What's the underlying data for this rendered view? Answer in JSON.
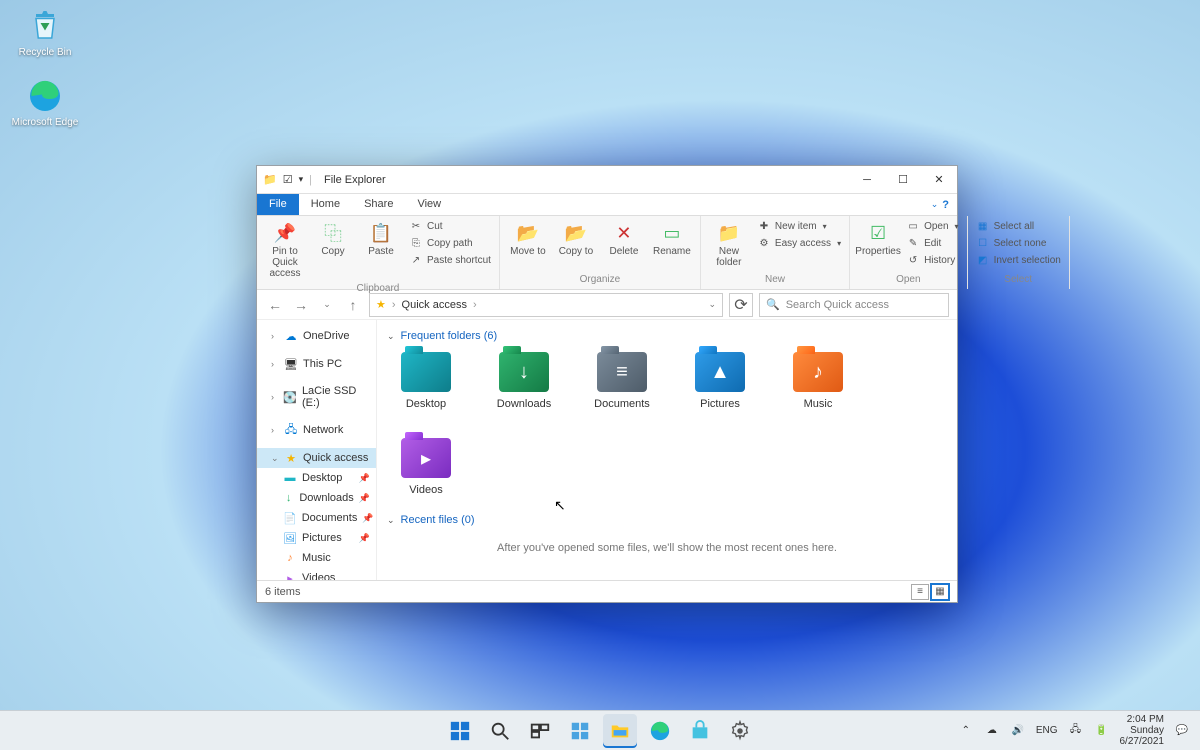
{
  "desktop": {
    "recycle": "Recycle Bin",
    "edge": "Microsoft Edge"
  },
  "window": {
    "title": "File Explorer",
    "tabs": {
      "file": "File",
      "home": "Home",
      "share": "Share",
      "view": "View"
    },
    "ribbon": {
      "clipboard": {
        "label": "Clipboard",
        "pin": "Pin to Quick access",
        "copy": "Copy",
        "paste": "Paste",
        "cut": "Cut",
        "copy_path": "Copy path",
        "paste_shortcut": "Paste shortcut"
      },
      "organize": {
        "label": "Organize",
        "move": "Move to",
        "copy": "Copy to",
        "delete": "Delete",
        "rename": "Rename"
      },
      "new": {
        "label": "New",
        "new_folder": "New folder",
        "new_item": "New item",
        "easy_access": "Easy access"
      },
      "open": {
        "label": "Open",
        "properties": "Properties",
        "open": "Open",
        "edit": "Edit",
        "history": "History"
      },
      "select": {
        "label": "Select",
        "all": "Select all",
        "none": "Select none",
        "invert": "Invert selection"
      }
    },
    "address": {
      "crumb": "Quick access"
    },
    "search_placeholder": "Search Quick access",
    "nav": {
      "onedrive": "OneDrive",
      "thispc": "This PC",
      "lacie": "LaCie SSD (E:)",
      "network": "Network",
      "quick": "Quick access",
      "desktop": "Desktop",
      "downloads": "Downloads",
      "documents": "Documents",
      "pictures": "Pictures",
      "music": "Music",
      "videos": "Videos"
    },
    "sections": {
      "frequent": "Frequent folders (6)",
      "recent": "Recent files (0)"
    },
    "folders": [
      {
        "label": "Desktop",
        "color": "c-teal",
        "glyph": ""
      },
      {
        "label": "Downloads",
        "color": "c-green",
        "glyph": "↓"
      },
      {
        "label": "Documents",
        "color": "c-grey",
        "glyph": "≡"
      },
      {
        "label": "Pictures",
        "color": "c-blue",
        "glyph": "▲"
      },
      {
        "label": "Music",
        "color": "c-orange",
        "glyph": "♪"
      },
      {
        "label": "Videos",
        "color": "c-purple",
        "glyph": "▸"
      }
    ],
    "empty_recent": "After you've opened some files, we'll show the most recent ones here.",
    "status": "6 items"
  },
  "tray": {
    "lang": "ENG",
    "time": "2:04 PM",
    "day": "Sunday",
    "date": "6/27/2021"
  }
}
